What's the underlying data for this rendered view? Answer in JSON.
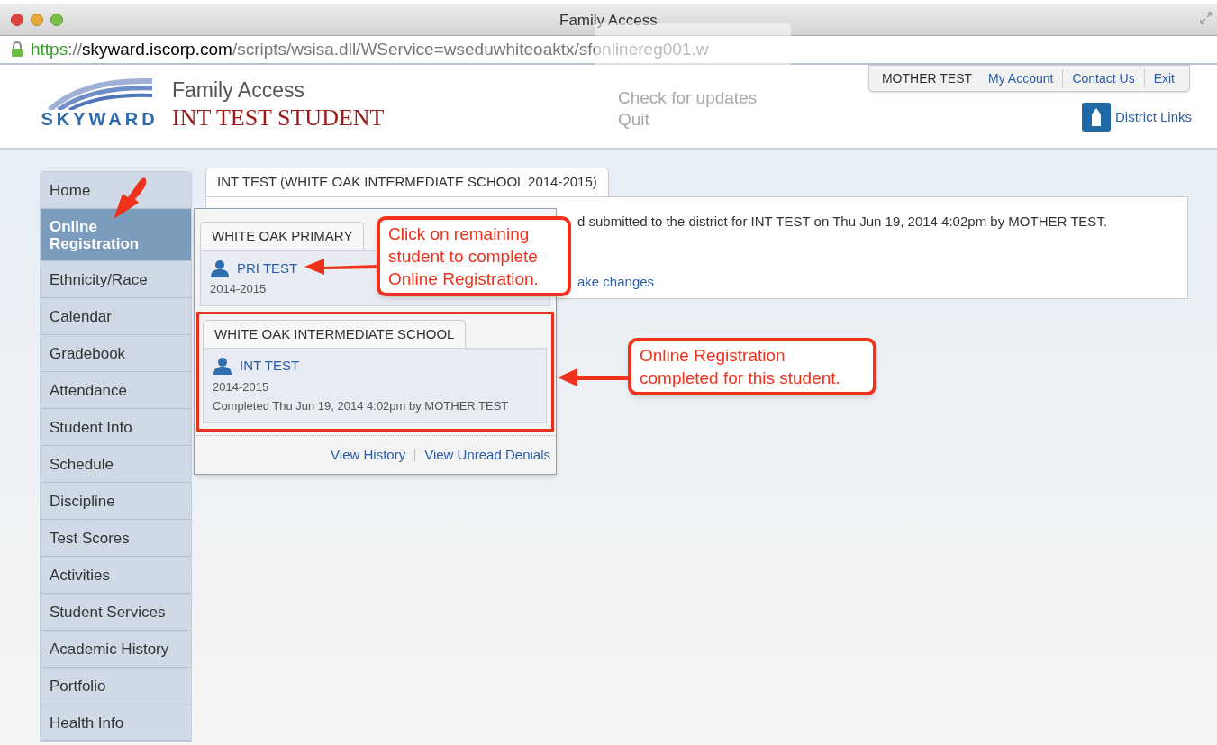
{
  "window": {
    "title": "Family Access"
  },
  "ghost_menu": [
    "Check for updates",
    "Quit"
  ],
  "address_bar": {
    "scheme": "https",
    "separator": "://",
    "host": "skyward.iscorp.com",
    "path": "/scripts/wsisa.dll/WService=wseduwhiteoaktx/sfonlinereg001.w"
  },
  "header": {
    "logo_text": "SKYWARD",
    "app_name": "Family Access",
    "student": "INT TEST STUDENT",
    "user": "MOTHER TEST",
    "links": [
      "My Account",
      "Contact Us",
      "Exit"
    ],
    "district_link": "District Links"
  },
  "sidebar": {
    "items": [
      {
        "label": "Home",
        "selected": false
      },
      {
        "label": "Online Registration",
        "selected": true
      },
      {
        "label": "Ethnicity/Race",
        "selected": false
      },
      {
        "label": "Calendar",
        "selected": false
      },
      {
        "label": "Gradebook",
        "selected": false
      },
      {
        "label": "Attendance",
        "selected": false
      },
      {
        "label": "Student Info",
        "selected": false
      },
      {
        "label": "Schedule",
        "selected": false
      },
      {
        "label": "Discipline",
        "selected": false
      },
      {
        "label": "Test Scores",
        "selected": false
      },
      {
        "label": "Activities",
        "selected": false
      },
      {
        "label": "Student Services",
        "selected": false
      },
      {
        "label": "Academic History",
        "selected": false
      },
      {
        "label": "Portfolio",
        "selected": false
      },
      {
        "label": "Health Info",
        "selected": false
      }
    ]
  },
  "main": {
    "tab": "INT TEST (WHITE OAK INTERMEDIATE SCHOOL 2014-2015)",
    "message": "d submitted to the district for INT TEST on Thu Jun 19, 2014 4:02pm by MOTHER TEST.",
    "link": "ake changes"
  },
  "popup": {
    "schools": [
      {
        "name": "WHITE OAK PRIMARY",
        "highlighted": false,
        "students": [
          {
            "name": "PRI TEST",
            "year": "2014-2015"
          }
        ]
      },
      {
        "name": "WHITE OAK INTERMEDIATE SCHOOL",
        "highlighted": true,
        "students": [
          {
            "name": "INT TEST",
            "year": "2014-2015",
            "status": "Completed Thu Jun 19, 2014 4:02pm by MOTHER TEST"
          }
        ]
      }
    ],
    "links": [
      "View History",
      "View Unread Denials"
    ]
  },
  "callouts": [
    "Click on remaining student to complete Online Registration.",
    "Online Registration completed for this student."
  ]
}
